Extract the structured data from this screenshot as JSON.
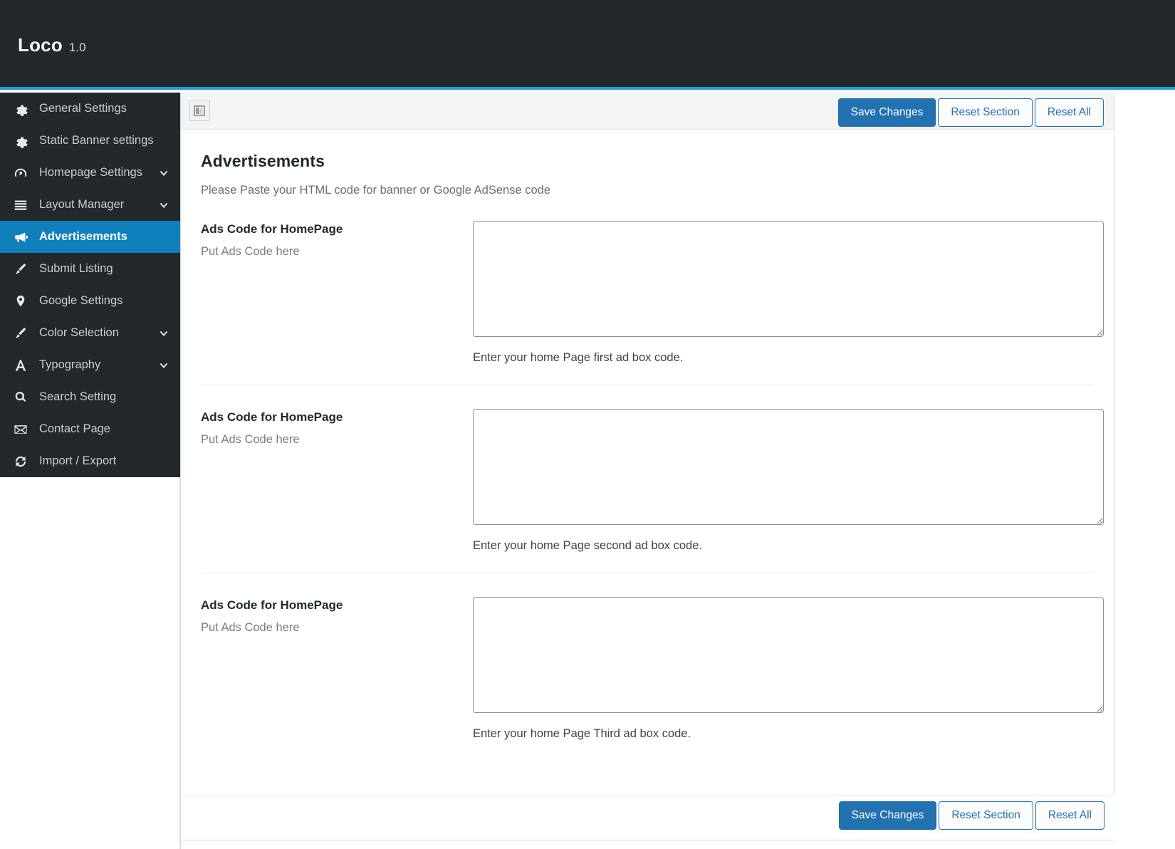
{
  "header": {
    "brand_name": "Loco",
    "version": "1.0",
    "accent_color": "#1e9bd7",
    "background_color": "#23282d"
  },
  "sidebar": {
    "background_color": "#23282d",
    "active_color": "#1080bd",
    "items": [
      {
        "label": "General Settings",
        "icon": "gear-icon",
        "caret": false,
        "active": false
      },
      {
        "label": "Static Banner settings",
        "icon": "gear-icon",
        "caret": false,
        "active": false
      },
      {
        "label": "Homepage Settings",
        "icon": "gauge-icon",
        "caret": true,
        "active": false
      },
      {
        "label": "Layout Manager",
        "icon": "layers-icon",
        "caret": true,
        "active": false
      },
      {
        "label": "Advertisements",
        "icon": "megaphone-icon",
        "caret": false,
        "active": true
      },
      {
        "label": "Submit Listing",
        "icon": "brush-icon",
        "caret": false,
        "active": false
      },
      {
        "label": "Google Settings",
        "icon": "map-pin-icon",
        "caret": false,
        "active": false
      },
      {
        "label": "Color Selection",
        "icon": "brush-icon",
        "caret": true,
        "active": false
      },
      {
        "label": "Typography",
        "icon": "letter-a-icon",
        "caret": true,
        "active": false
      },
      {
        "label": "Search Setting",
        "icon": "search-icon",
        "caret": false,
        "active": false
      },
      {
        "label": "Contact Page",
        "icon": "envelope-icon",
        "caret": false,
        "active": false
      },
      {
        "label": "Import / Export",
        "icon": "refresh-icon",
        "caret": false,
        "active": false
      }
    ]
  },
  "toolbar": {
    "panel_toggle_icon": "panel-layout-icon",
    "save_label": "Save Changes",
    "reset_section_label": "Reset Section",
    "reset_all_label": "Reset All",
    "primary_color": "#2271b1"
  },
  "main": {
    "title": "Advertisements",
    "subtitle": "Please Paste your HTML code for banner or Google AdSense code",
    "fields": [
      {
        "title": "Ads Code for HomePage",
        "hint": "Put Ads Code here",
        "value": "",
        "placeholder": "",
        "description": "Enter your home Page first ad box code."
      },
      {
        "title": "Ads Code for HomePage",
        "hint": "Put Ads Code here",
        "value": "",
        "placeholder": "",
        "description": "Enter your home Page second ad box code."
      },
      {
        "title": "Ads Code for HomePage",
        "hint": "Put Ads Code here",
        "value": "",
        "placeholder": "",
        "description": "Enter your home Page Third ad box code."
      }
    ]
  },
  "footer": {
    "save_label": "Save Changes",
    "reset_section_label": "Reset Section",
    "reset_all_label": "Reset All"
  }
}
